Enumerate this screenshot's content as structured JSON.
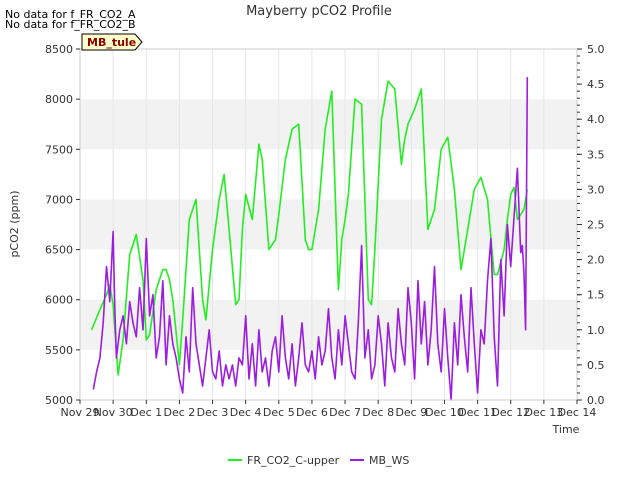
{
  "notes": [
    "No data for f_FR_CO2_A",
    "No data for f_FR_CO2_B"
  ],
  "badge": {
    "label": "MB_tule",
    "fill": "#ffffcc",
    "text_color": "#8b0000"
  },
  "chart_data": {
    "type": "line",
    "title": "Mayberry pCO2 Profile",
    "xlabel": "Time",
    "ylabel": "pCO2 (ppm)",
    "y2label": "",
    "x_ticks": [
      "Nov 29",
      "Nov 30",
      "Dec 1",
      "Dec 2",
      "Dec 3",
      "Dec 4",
      "Dec 5",
      "Dec 6",
      "Dec 7",
      "Dec 8",
      "Dec 9",
      "Dec 10",
      "Dec 11",
      "Dec 12",
      "Dec 13",
      "Dec 14"
    ],
    "xlim_days": [
      0,
      15
    ],
    "ylim": [
      5000,
      8500
    ],
    "y_ticks": [
      5000,
      5500,
      6000,
      6500,
      7000,
      7500,
      8000,
      8500
    ],
    "y2lim": [
      0,
      5.0
    ],
    "y2_ticks": [
      "0.0",
      "0.5",
      "1.0",
      "1.5",
      "2.0",
      "2.5",
      "3.0",
      "3.5",
      "4.0",
      "4.5",
      "5.0"
    ],
    "background_bands": "alternating light grey bands every 500 ppm",
    "legend_position": "bottom-center",
    "series": [
      {
        "name": "FR_CO2_C-upper",
        "axis": "left",
        "color": "#22ee22",
        "day_offset": [
          0.35,
          0.6,
          0.8,
          0.9,
          1.0,
          1.15,
          1.3,
          1.5,
          1.7,
          1.9,
          2.0,
          2.1,
          2.3,
          2.5,
          2.6,
          2.7,
          2.8,
          3.0,
          3.1,
          3.3,
          3.5,
          3.7,
          3.8,
          4.0,
          4.2,
          4.35,
          4.5,
          4.7,
          4.8,
          4.9,
          5.0,
          5.2,
          5.4,
          5.5,
          5.7,
          5.9,
          6.0,
          6.2,
          6.4,
          6.6,
          6.8,
          6.9,
          7.0,
          7.2,
          7.4,
          7.6,
          7.8,
          7.9,
          8.0,
          8.1,
          8.3,
          8.5,
          8.7,
          8.8,
          8.9,
          9.1,
          9.3,
          9.5,
          9.7,
          9.8,
          9.9,
          10.1,
          10.3,
          10.5,
          10.7,
          10.9,
          11.1,
          11.3,
          11.5,
          11.7,
          11.9,
          12.1,
          12.3,
          12.5,
          12.6,
          12.8,
          12.9,
          13.0,
          13.1,
          13.2,
          13.3,
          13.4,
          13.5
        ],
        "values": [
          5700,
          5900,
          6050,
          6150,
          5950,
          5250,
          5600,
          6450,
          6650,
          6200,
          5600,
          5650,
          6100,
          6300,
          6300,
          6200,
          6000,
          5350,
          5800,
          6800,
          7000,
          6000,
          5800,
          6500,
          7000,
          7250,
          6700,
          5950,
          6000,
          6700,
          7050,
          6800,
          7550,
          7400,
          6500,
          6600,
          6850,
          7400,
          7700,
          7750,
          6600,
          6500,
          6500,
          6900,
          7700,
          8080,
          6100,
          6600,
          6800,
          7050,
          8000,
          7950,
          6000,
          5950,
          6500,
          7800,
          8180,
          8100,
          7350,
          7600,
          7750,
          7900,
          8100,
          6700,
          6900,
          7500,
          7620,
          7100,
          6300,
          6700,
          7100,
          7220,
          7000,
          6250,
          6250,
          6500,
          6800,
          7050,
          7120,
          6800,
          6850,
          6900,
          7100
        ]
      },
      {
        "name": "MB_WS",
        "axis": "right",
        "color": "#9b1ee0",
        "day_offset": [
          0.4,
          0.5,
          0.6,
          0.7,
          0.8,
          0.9,
          1.0,
          1.05,
          1.1,
          1.2,
          1.3,
          1.4,
          1.5,
          1.6,
          1.7,
          1.8,
          1.9,
          2.0,
          2.1,
          2.2,
          2.3,
          2.4,
          2.5,
          2.6,
          2.7,
          2.8,
          2.9,
          3.0,
          3.1,
          3.2,
          3.3,
          3.4,
          3.5,
          3.6,
          3.7,
          3.8,
          3.9,
          4.0,
          4.1,
          4.2,
          4.3,
          4.4,
          4.5,
          4.6,
          4.7,
          4.8,
          4.9,
          5.0,
          5.1,
          5.2,
          5.3,
          5.4,
          5.5,
          5.6,
          5.7,
          5.8,
          5.9,
          6.0,
          6.1,
          6.2,
          6.3,
          6.4,
          6.5,
          6.6,
          6.7,
          6.8,
          6.9,
          7.0,
          7.1,
          7.2,
          7.3,
          7.4,
          7.5,
          7.6,
          7.7,
          7.8,
          7.9,
          8.0,
          8.1,
          8.2,
          8.3,
          8.4,
          8.5,
          8.6,
          8.7,
          8.8,
          8.9,
          9.0,
          9.1,
          9.2,
          9.3,
          9.4,
          9.5,
          9.6,
          9.7,
          9.8,
          9.9,
          10.0,
          10.1,
          10.2,
          10.3,
          10.4,
          10.5,
          10.6,
          10.7,
          10.8,
          10.9,
          11.0,
          11.1,
          11.2,
          11.3,
          11.4,
          11.5,
          11.6,
          11.7,
          11.8,
          11.9,
          12.0,
          12.1,
          12.2,
          12.3,
          12.4,
          12.5,
          12.6,
          12.7,
          12.8,
          12.9,
          13.0,
          13.1,
          13.2,
          13.3,
          13.35,
          13.4,
          13.45,
          13.5
        ],
        "values": [
          0.15,
          0.4,
          0.6,
          1.1,
          1.9,
          1.4,
          2.4,
          1.3,
          0.6,
          1.0,
          1.2,
          0.8,
          1.4,
          1.1,
          0.9,
          1.6,
          1.0,
          2.3,
          1.2,
          1.5,
          0.6,
          0.9,
          1.7,
          0.5,
          1.2,
          0.8,
          0.6,
          0.3,
          0.1,
          0.9,
          0.4,
          1.6,
          0.8,
          0.5,
          0.2,
          0.6,
          1.0,
          0.4,
          0.3,
          0.7,
          0.2,
          0.5,
          0.3,
          0.5,
          0.2,
          0.6,
          0.5,
          1.2,
          0.3,
          0.8,
          0.2,
          1.0,
          0.4,
          0.6,
          0.2,
          0.7,
          0.9,
          0.4,
          1.2,
          0.6,
          0.3,
          0.8,
          0.2,
          0.6,
          1.1,
          0.5,
          0.4,
          0.7,
          0.3,
          0.9,
          0.5,
          0.7,
          1.3,
          0.6,
          0.3,
          1.0,
          0.5,
          1.2,
          0.8,
          0.4,
          0.3,
          1.1,
          2.2,
          0.6,
          1.0,
          0.3,
          0.5,
          1.2,
          0.8,
          0.2,
          1.1,
          0.6,
          0.4,
          1.3,
          0.8,
          0.5,
          1.6,
          1.1,
          0.3,
          1.7,
          0.8,
          1.4,
          0.5,
          1.0,
          1.9,
          0.8,
          0.4,
          1.3,
          0.6,
          0.0,
          1.1,
          0.5,
          1.5,
          0.9,
          0.4,
          1.6,
          0.8,
          0.1,
          1.0,
          0.8,
          1.7,
          2.3,
          0.9,
          0.2,
          2.0,
          1.2,
          2.5,
          1.9,
          2.6,
          3.3,
          2.1,
          2.2,
          1.8,
          1.0,
          4.6,
          4.0
        ]
      }
    ]
  }
}
